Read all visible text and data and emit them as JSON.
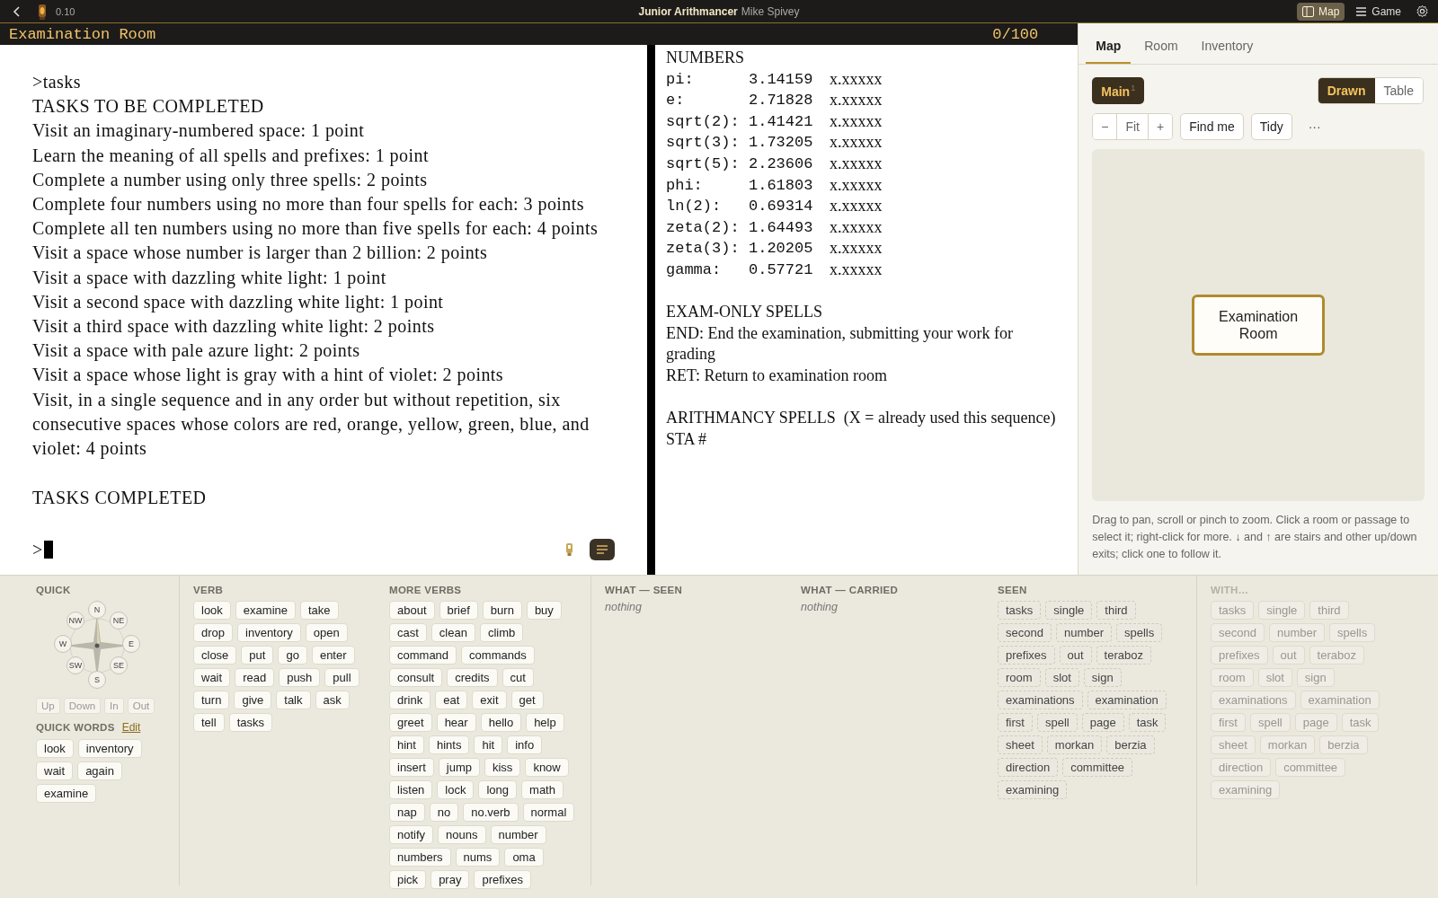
{
  "topbar": {
    "version": "0.10",
    "title": "Junior Arithmancer",
    "author": "Mike Spivey",
    "buttons": [
      {
        "label": "Map",
        "selected": true
      },
      {
        "label": "Game",
        "selected": false
      }
    ]
  },
  "status_line": {
    "location": "Examination Room",
    "score": "0/100"
  },
  "transcript": {
    "blocks": [
      {
        "lines": [
          ">tasks",
          "TASKS TO BE COMPLETED",
          "Visit an imaginary-numbered space: 1 point",
          "Learn the meaning of all spells and prefixes: 1 point",
          "Complete a number using only three spells: 2 points",
          "Complete four numbers using no more than four spells for each: 3 points",
          "Complete all ten numbers using no more than five spells for each: 4 points",
          "Visit a space whose number is larger than 2 billion: 2 points",
          "Visit a space with dazzling white light: 1 point",
          "Visit a second space with dazzling white light: 1 point",
          "Visit a third space with dazzling white light: 2 points",
          "Visit a space with pale azure light: 2 points",
          "Visit a space whose light is gray with a hint of violet: 2 points",
          "Visit, in a single sequence and in any order but without repetition, six consecutive spaces whose colors are red, orange, yellow, green, blue, and violet: 4 points"
        ]
      },
      {
        "lines": [
          "TASKS COMPLETED"
        ]
      }
    ],
    "prompt": ">"
  },
  "status_window": {
    "sections": [
      {
        "kind": "table",
        "heading": "NUMBERS",
        "rows": [
          {
            "name": "pi:",
            "value": "3.14159",
            "work": "x.xxxxx"
          },
          {
            "name": "e:",
            "value": "2.71828",
            "work": "x.xxxxx"
          },
          {
            "name": "sqrt(2):",
            "value": "1.41421",
            "work": "x.xxxxx"
          },
          {
            "name": "sqrt(3):",
            "value": "1.73205",
            "work": "x.xxxxx"
          },
          {
            "name": "sqrt(5):",
            "value": "2.23606",
            "work": "x.xxxxx"
          },
          {
            "name": "phi:",
            "value": "1.61803",
            "work": "x.xxxxx"
          },
          {
            "name": "ln(2):",
            "value": "0.69314",
            "work": "x.xxxxx"
          },
          {
            "name": "zeta(2):",
            "value": "1.64493",
            "work": "x.xxxxx"
          },
          {
            "name": "zeta(3):",
            "value": "1.20205",
            "work": "x.xxxxx"
          },
          {
            "name": "gamma:",
            "value": "0.57721",
            "work": "x.xxxxx"
          }
        ]
      },
      {
        "kind": "text",
        "lines": [
          "EXAM-ONLY SPELLS",
          "END: End the examination, submitting your work for grading",
          "RET: Return to examination room"
        ]
      },
      {
        "kind": "text",
        "lines": [
          "ARITHMANCY SPELLS  (X = already used this sequence)",
          "STA #"
        ]
      }
    ]
  },
  "side_panel": {
    "tabs": [
      {
        "label": "Map",
        "selected": true
      },
      {
        "label": "Room",
        "selected": false
      },
      {
        "label": "Inventory",
        "selected": false
      }
    ],
    "level": {
      "label": "Main",
      "count": "1"
    },
    "views": [
      {
        "label": "Drawn",
        "selected": true
      },
      {
        "label": "Table",
        "selected": false
      }
    ],
    "zoom": [
      "−",
      "Fit",
      "+"
    ],
    "tools": [
      "Find me",
      "Tidy"
    ],
    "more": "···",
    "rooms": [
      {
        "label": "Examination Room",
        "current": true
      }
    ],
    "help": "Drag to pan, scroll or pinch to zoom. Click a room or passage to select it; right-click for more. ↓ and ↑ are stairs and other up/down exits; click one to follow it."
  },
  "quick": {
    "heading": "QUICK",
    "compass": [
      {
        "label": "N"
      },
      {
        "label": "NE"
      },
      {
        "label": "E"
      },
      {
        "label": "SE"
      },
      {
        "label": "S"
      },
      {
        "label": "SW"
      },
      {
        "label": "W"
      },
      {
        "label": "NW"
      }
    ],
    "moves": [
      {
        "label": "Up",
        "disabled": true
      },
      {
        "label": "Down",
        "disabled": true
      },
      {
        "label": "In",
        "disabled": true
      },
      {
        "label": "Out",
        "disabled": true
      }
    ],
    "words_heading": "QUICK WORDS",
    "edit": "Edit",
    "words": [
      "look",
      "inventory",
      "wait",
      "again",
      "examine"
    ]
  },
  "columns": [
    {
      "heading": "VERB",
      "kind": "verbs",
      "disabled": false,
      "items": [
        "look",
        "examine",
        "take",
        "drop",
        "inventory",
        "open",
        "close",
        "put",
        "go",
        "enter",
        "wait",
        "read",
        "push",
        "pull",
        "turn",
        "give",
        "talk",
        "ask",
        "tell",
        "tasks"
      ]
    },
    {
      "heading": "MORE VERBS",
      "kind": "verbs",
      "disabled": false,
      "items": [
        "about",
        "brief",
        "burn",
        "buy",
        "cast",
        "clean",
        "climb",
        "command",
        "commands",
        "consult",
        "credits",
        "cut",
        "drink",
        "eat",
        "exit",
        "get",
        "greet",
        "hear",
        "hello",
        "help",
        "hint",
        "hints",
        "hit",
        "info",
        "insert",
        "jump",
        "kiss",
        "know",
        "listen",
        "lock",
        "long",
        "math",
        "nap",
        "no",
        "no.verb",
        "normal",
        "notify",
        "nouns",
        "number",
        "numbers",
        "nums",
        "oma",
        "pick",
        "pray",
        "prefixes"
      ]
    },
    {
      "heading": "WHAT — SEEN",
      "kind": "empty",
      "disabled": false,
      "note": "nothing"
    },
    {
      "heading": "WHAT — CARRIED",
      "kind": "empty",
      "disabled": false,
      "note": "nothing"
    },
    {
      "heading": "SEEN",
      "kind": "nouns",
      "disabled": false,
      "items": [
        "tasks",
        "single",
        "third",
        "second",
        "number",
        "spells",
        "prefixes",
        "out",
        "teraboz",
        "room",
        "slot",
        "sign",
        "examinations",
        "examination",
        "first",
        "spell",
        "page",
        "task",
        "sheet",
        "morkan",
        "berzia",
        "direction",
        "committee",
        "examining"
      ]
    },
    {
      "heading": "WITH…",
      "kind": "nouns",
      "disabled": true,
      "items": [
        "tasks",
        "single",
        "third",
        "second",
        "number",
        "spells",
        "prefixes",
        "out",
        "teraboz",
        "room",
        "slot",
        "sign",
        "examinations",
        "examination",
        "first",
        "spell",
        "page",
        "task",
        "sheet",
        "morkan",
        "berzia",
        "direction",
        "committee",
        "examining"
      ]
    }
  ]
}
